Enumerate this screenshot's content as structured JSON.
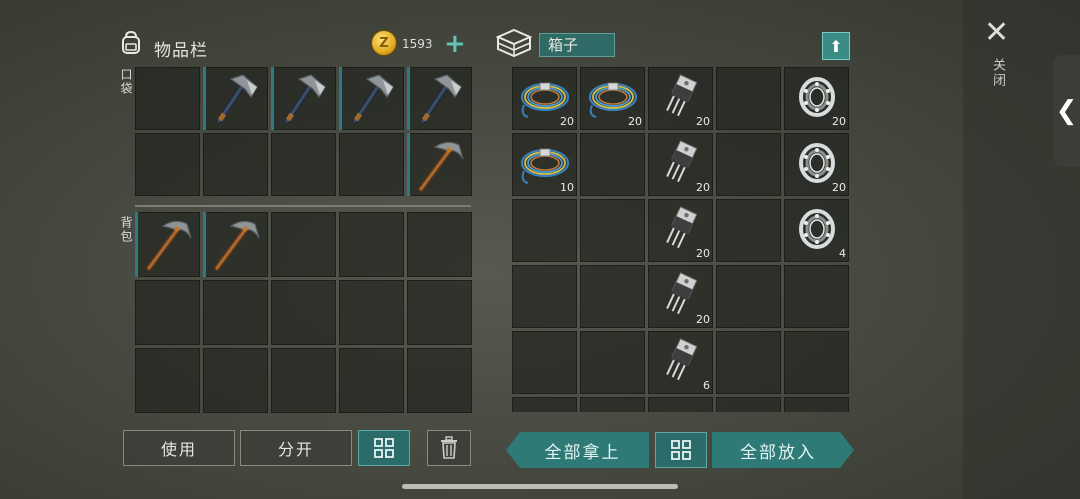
{
  "inventory": {
    "title": "物品栏",
    "currency": "1593",
    "coin_glyph": "Z",
    "plus_label": "+",
    "pocket_label": "口袋",
    "backpack_label": "背包",
    "pocket_slots": [
      {
        "item": "",
        "qty": ""
      },
      {
        "item": "hatchet",
        "qty": ""
      },
      {
        "item": "hatchet",
        "qty": ""
      },
      {
        "item": "hatchet",
        "qty": ""
      },
      {
        "item": "hatchet",
        "qty": ""
      },
      {
        "item": "",
        "qty": ""
      },
      {
        "item": "",
        "qty": ""
      },
      {
        "item": "",
        "qty": ""
      },
      {
        "item": "",
        "qty": ""
      },
      {
        "item": "pickaxe",
        "qty": ""
      }
    ],
    "backpack_slots": [
      {
        "item": "pickaxe",
        "qty": ""
      },
      {
        "item": "pickaxe",
        "qty": ""
      },
      {
        "item": "",
        "qty": ""
      },
      {
        "item": "",
        "qty": ""
      },
      {
        "item": "",
        "qty": ""
      },
      {
        "item": "",
        "qty": ""
      },
      {
        "item": "",
        "qty": ""
      },
      {
        "item": "",
        "qty": ""
      },
      {
        "item": "",
        "qty": ""
      },
      {
        "item": "",
        "qty": ""
      },
      {
        "item": "",
        "qty": ""
      },
      {
        "item": "",
        "qty": ""
      },
      {
        "item": "",
        "qty": ""
      },
      {
        "item": "",
        "qty": ""
      },
      {
        "item": "",
        "qty": ""
      }
    ]
  },
  "container": {
    "name": "箱子",
    "upload_label": "⬆",
    "slots": [
      {
        "item": "wire",
        "qty": "20"
      },
      {
        "item": "wire",
        "qty": "20"
      },
      {
        "item": "transistor",
        "qty": "20"
      },
      {
        "item": "",
        "qty": ""
      },
      {
        "item": "bearing",
        "qty": "20"
      },
      {
        "item": "wire",
        "qty": "10"
      },
      {
        "item": "",
        "qty": ""
      },
      {
        "item": "transistor",
        "qty": "20"
      },
      {
        "item": "",
        "qty": ""
      },
      {
        "item": "bearing",
        "qty": "20"
      },
      {
        "item": "",
        "qty": ""
      },
      {
        "item": "",
        "qty": ""
      },
      {
        "item": "transistor",
        "qty": "20"
      },
      {
        "item": "",
        "qty": ""
      },
      {
        "item": "bearing",
        "qty": "4"
      },
      {
        "item": "",
        "qty": ""
      },
      {
        "item": "",
        "qty": ""
      },
      {
        "item": "transistor",
        "qty": "20"
      },
      {
        "item": "",
        "qty": ""
      },
      {
        "item": "",
        "qty": ""
      },
      {
        "item": "",
        "qty": ""
      },
      {
        "item": "",
        "qty": ""
      },
      {
        "item": "transistor",
        "qty": "6"
      },
      {
        "item": "",
        "qty": ""
      },
      {
        "item": "",
        "qty": ""
      }
    ]
  },
  "buttons": {
    "use": "使用",
    "split": "分开",
    "take_all": "全部拿上",
    "put_all": "全部放入"
  },
  "close": {
    "icon": "✕",
    "label": "关闭"
  },
  "tab_handle": "❮",
  "colors": {
    "accent": "#2d7a76",
    "slot_marker": "#2f7a80",
    "coin": "#e2a920"
  }
}
